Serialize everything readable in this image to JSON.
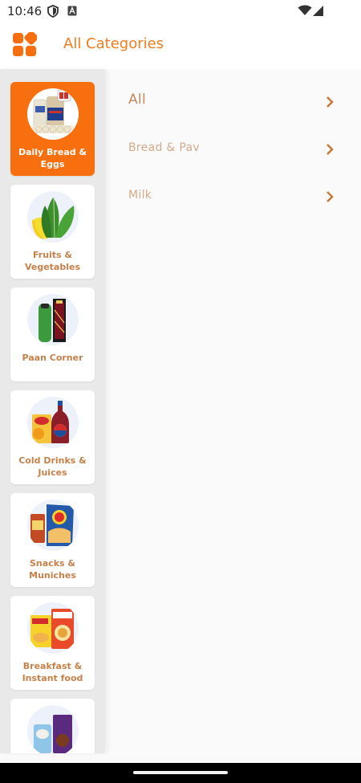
{
  "status": {
    "time": "10:46",
    "icons": [
      "shield-icon",
      "a-box-icon",
      "wifi-icon",
      "signal-icon"
    ]
  },
  "header": {
    "title": "All Categories",
    "logo": "categories-grid-icon",
    "accent": "#f07c1e"
  },
  "sidebar": {
    "items": [
      {
        "label": "Daily Bread & Eggs",
        "active": true,
        "image": "bread-eggs-image"
      },
      {
        "label": "Fruits & Vegetables",
        "active": false,
        "image": "fruits-vegetables-image"
      },
      {
        "label": "Paan Corner",
        "active": false,
        "image": "paan-corner-image"
      },
      {
        "label": "Cold Drinks & Juices",
        "active": false,
        "image": "cold-drinks-image"
      },
      {
        "label": "Snacks & Muniches",
        "active": false,
        "image": "snacks-image"
      },
      {
        "label": "Breakfast & Instant food",
        "active": false,
        "image": "breakfast-image"
      },
      {
        "label": "",
        "active": false,
        "image": "ice-cream-chocolate-image"
      }
    ]
  },
  "subcategories": [
    {
      "label": "All"
    },
    {
      "label": "Bread & Pav"
    },
    {
      "label": "Milk"
    }
  ],
  "colors": {
    "active_card": "#f86f0f",
    "sidebar_bg": "#e9e9e9",
    "label_brown": "#c58149"
  }
}
